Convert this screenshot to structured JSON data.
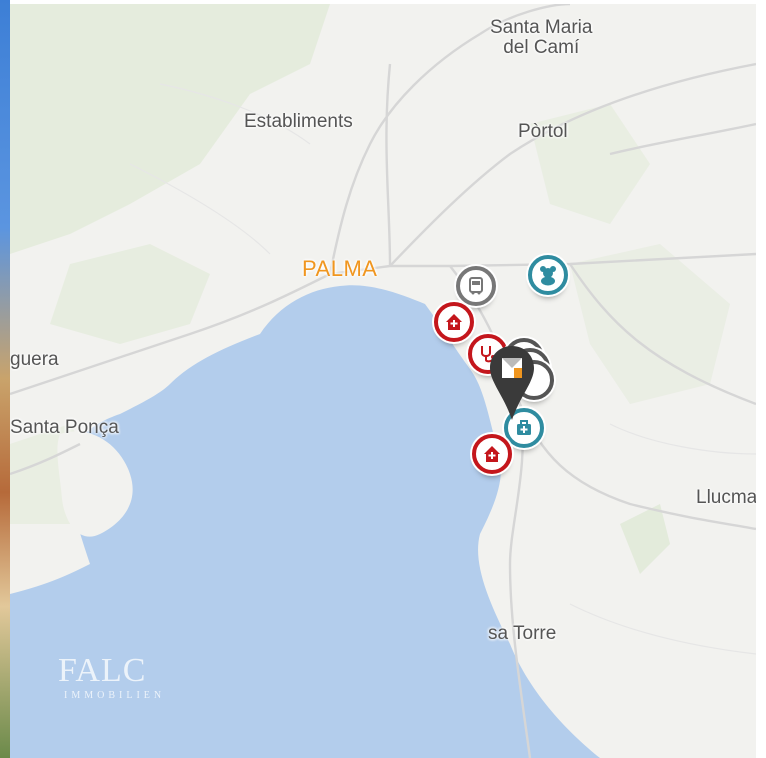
{
  "map": {
    "places": [
      {
        "id": "santa-maria",
        "text": "Santa Maria\ndel Camí"
      },
      {
        "id": "establiments",
        "text": "Establiments"
      },
      {
        "id": "portol",
        "text": "Pòrtol"
      },
      {
        "id": "palma",
        "text": "PALMA"
      },
      {
        "id": "guera",
        "text": "guera"
      },
      {
        "id": "santa-ponca",
        "text": "Santa Ponça"
      },
      {
        "id": "llucma",
        "text": "Llucma"
      },
      {
        "id": "sa-torre",
        "text": "sa Torre"
      }
    ],
    "poi_icons": [
      {
        "kind": "hospital",
        "color": "red",
        "icon": "house-cross-icon"
      },
      {
        "kind": "bus",
        "color": "grey",
        "icon": "bus-icon"
      },
      {
        "kind": "kindergarten",
        "color": "teal",
        "icon": "teddy-bear-icon"
      },
      {
        "kind": "doctor",
        "color": "red",
        "icon": "stethoscope-icon"
      },
      {
        "kind": "pharmacy",
        "color": "teal",
        "icon": "medical-bag-icon"
      },
      {
        "kind": "hospital-2",
        "color": "red",
        "icon": "house-cross-icon"
      }
    ],
    "property_marker": "property-pin-icon",
    "colors": {
      "water": "#b3cdec",
      "land": "#f2f2ef",
      "park": "#dde9d3",
      "city_label": "#f0961f",
      "poi_red": "#c4161c",
      "poi_teal": "#2f8ca0"
    }
  },
  "watermark": {
    "logo_text": "FALC",
    "sub_text": "IMMOBILIEN"
  }
}
